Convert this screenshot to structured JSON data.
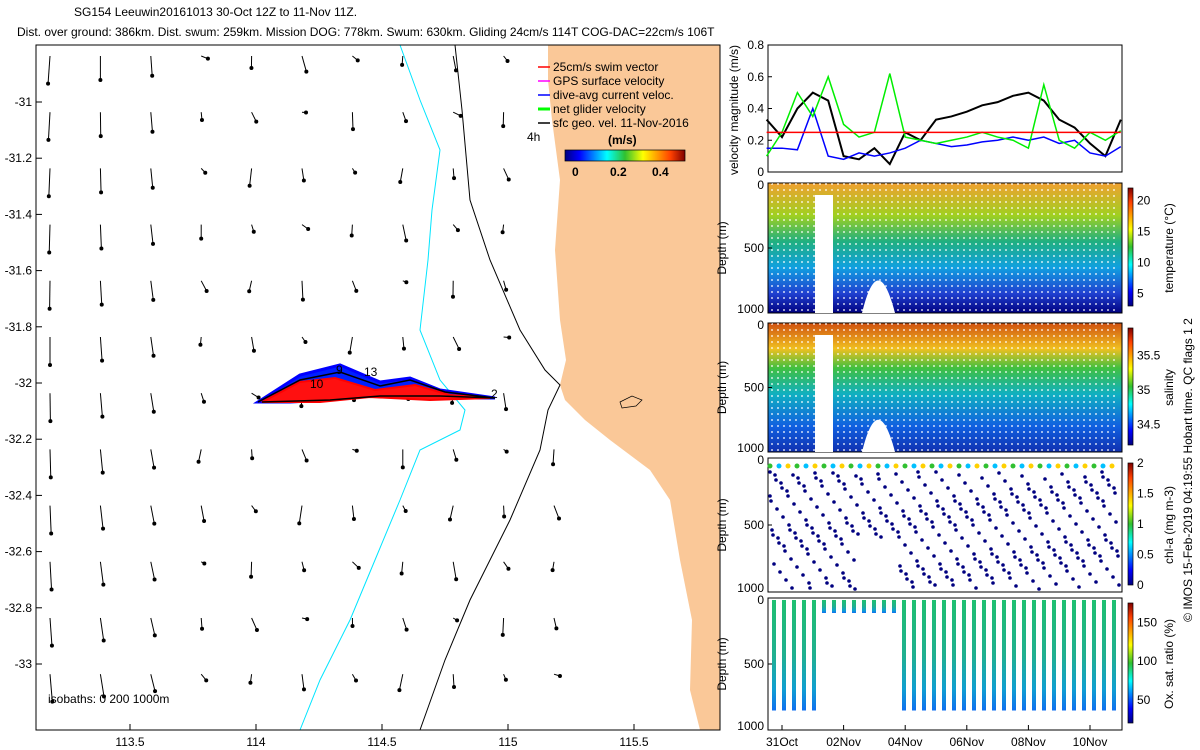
{
  "header": {
    "line1": "SG154 Leeuwin20161013 30-Oct 12Z to 11-Nov 11Z.",
    "line2": "Dist. over ground: 386km. Dist. swum: 259km. Mission DOG: 778km. Swum: 630km. Gliding 24cm/s 114T COG-DAC=22cm/s 106T"
  },
  "map": {
    "lon_ticks": [
      "113.5",
      "114",
      "114.5",
      "115",
      "115.5"
    ],
    "lat_ticks": [
      "-31",
      "-31.2",
      "-31.4",
      "-31.6",
      "-31.8",
      "-32",
      "-32.2",
      "-32.4",
      "-32.6",
      "-32.8",
      "-33"
    ],
    "legend": [
      {
        "label": "25cm/s swim vector",
        "color": "#ff0000"
      },
      {
        "label": "GPS surface velocity",
        "color": "#ff00ff"
      },
      {
        "label": "dive-avg current veloc.",
        "color": "#0000ff"
      },
      {
        "label": "net glider velocity",
        "color": "#00ff00"
      },
      {
        "label": "sfc geo. vel. 11-Nov-2016",
        "color": "#000000"
      }
    ],
    "legend_time": "4h",
    "colorbar_unit": "(m/s)",
    "colorbar_ticks": [
      "0",
      "0.2",
      "0.4"
    ],
    "isobaths": "isobaths: 0   200  1000m",
    "track_labels": [
      "9",
      "13",
      "10",
      "2"
    ],
    "colors": {
      "land": "#fac898",
      "isobath_200": "#000000",
      "isobath_1000": "#00e5ff"
    }
  },
  "velocity_panel": {
    "ylabel": "velocity magnitude (m/s)",
    "y_ticks": [
      "0",
      "0.2",
      "0.4",
      "0.6",
      "0.8"
    ],
    "ylim": [
      0,
      0.8
    ],
    "threshold": 0.25,
    "series": [
      {
        "color": "#000000",
        "days": [
          -0.5,
          0,
          0.5,
          1,
          1.5,
          2,
          2.5,
          3,
          3.5,
          4,
          4.5,
          5,
          5.5,
          6,
          6.5,
          7,
          7.5,
          8,
          8.5,
          9,
          9.5,
          10,
          10.5,
          11
        ],
        "values": [
          0.33,
          0.22,
          0.4,
          0.5,
          0.45,
          0.1,
          0.08,
          0.15,
          0.05,
          0.25,
          0.2,
          0.33,
          0.35,
          0.38,
          0.42,
          0.44,
          0.48,
          0.5,
          0.45,
          0.33,
          0.28,
          0.18,
          0.1,
          0.33
        ]
      },
      {
        "color": "#0000ff",
        "days": [
          -0.5,
          0,
          0.5,
          1,
          1.5,
          2,
          2.5,
          3,
          3.5,
          4,
          4.5,
          5,
          5.5,
          6,
          6.5,
          7,
          7.5,
          8,
          8.5,
          9,
          9.5,
          10,
          10.5,
          11
        ],
        "values": [
          0.15,
          0.15,
          0.14,
          0.4,
          0.1,
          0.08,
          0.12,
          0.1,
          0.12,
          0.15,
          0.2,
          0.18,
          0.16,
          0.17,
          0.19,
          0.2,
          0.22,
          0.2,
          0.22,
          0.18,
          0.2,
          0.12,
          0.1,
          0.16
        ]
      },
      {
        "color": "#00ee00",
        "days": [
          -0.5,
          0,
          0.5,
          1,
          1.5,
          2,
          2.5,
          3,
          3.5,
          4,
          4.5,
          5,
          5.5,
          6,
          6.5,
          7,
          7.5,
          8,
          8.5,
          9,
          9.5,
          10,
          10.5,
          11
        ],
        "values": [
          0.1,
          0.25,
          0.5,
          0.35,
          0.6,
          0.3,
          0.22,
          0.25,
          0.62,
          0.22,
          0.2,
          0.18,
          0.2,
          0.22,
          0.25,
          0.22,
          0.2,
          0.15,
          0.55,
          0.2,
          0.15,
          0.25,
          0.2,
          0.26
        ]
      },
      {
        "color": "#ff0000",
        "days": [
          -0.5,
          11
        ],
        "values": [
          0.25,
          0.25
        ]
      }
    ]
  },
  "sections": [
    {
      "id": "temperature",
      "ylabel": "Depth (m)",
      "cbar_label": "temperature (°C)",
      "cbar_ticks": [
        "5",
        "10",
        "15",
        "20"
      ],
      "cbar_range": [
        3,
        22
      ]
    },
    {
      "id": "salinity",
      "ylabel": "Depth (m)",
      "cbar_label": "salinity",
      "cbar_ticks": [
        "34.5",
        "35",
        "35.5"
      ],
      "cbar_range": [
        34.2,
        35.9
      ]
    },
    {
      "id": "chl",
      "ylabel": "Depth (m)",
      "cbar_label": "chl-a (mg m-3)",
      "cbar_ticks": [
        "0",
        "0.5",
        "1",
        "1.5",
        "2"
      ],
      "cbar_range": [
        0,
        2
      ]
    },
    {
      "id": "oxygen",
      "ylabel": "Depth (m)",
      "cbar_label": "Ox. sat. ratio (%)",
      "cbar_ticks": [
        "50",
        "100",
        "150"
      ],
      "cbar_range": [
        20,
        175
      ]
    }
  ],
  "depth_ticks": [
    "0",
    "500",
    "1000"
  ],
  "date_ticks": [
    "31Oct",
    "02Nov",
    "04Nov",
    "06Nov",
    "08Nov",
    "10Nov"
  ],
  "footer": "© IMOS 15-Feb-2019 04:19:55 Hobart time. QC flags 1  2"
}
